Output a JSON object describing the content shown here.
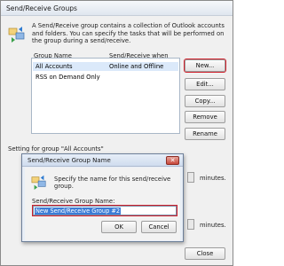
{
  "window": {
    "title": "Send/Receive Groups",
    "description": "A Send/Receive group contains a collection of Outlook accounts and folders. You can specify the tasks that will be performed on the group during a send/receive."
  },
  "list": {
    "columns": [
      "Group Name",
      "Send/Receive when"
    ],
    "rows": [
      {
        "name": "All Accounts",
        "when": "Online and Offline",
        "selected": true
      },
      {
        "name": "RSS on Demand Only",
        "when": "",
        "selected": false
      }
    ]
  },
  "buttons": {
    "new": "New...",
    "edit": "Edit...",
    "copy": "Copy...",
    "remove": "Remove",
    "rename": "Rename",
    "close": "Close"
  },
  "setting": {
    "label": "Setting for group \"All Accounts\"",
    "minutes_1": "minutes.",
    "minutes_2": "minutes."
  },
  "dialog": {
    "title": "Send/Receive Group Name",
    "description": "Specify the name for this send/receive group.",
    "field_label": "Send/Receive Group Name:",
    "field_value": "New Send/Receive Group #2",
    "ok": "OK",
    "cancel": "Cancel"
  },
  "colors": {
    "highlight_red": "#d2222d",
    "selection_blue": "#3b7cd6",
    "list_selected": "#dbe9fa"
  },
  "icons": {
    "group_icon": "send-receive-group-icon",
    "close_icon": "close-icon"
  }
}
